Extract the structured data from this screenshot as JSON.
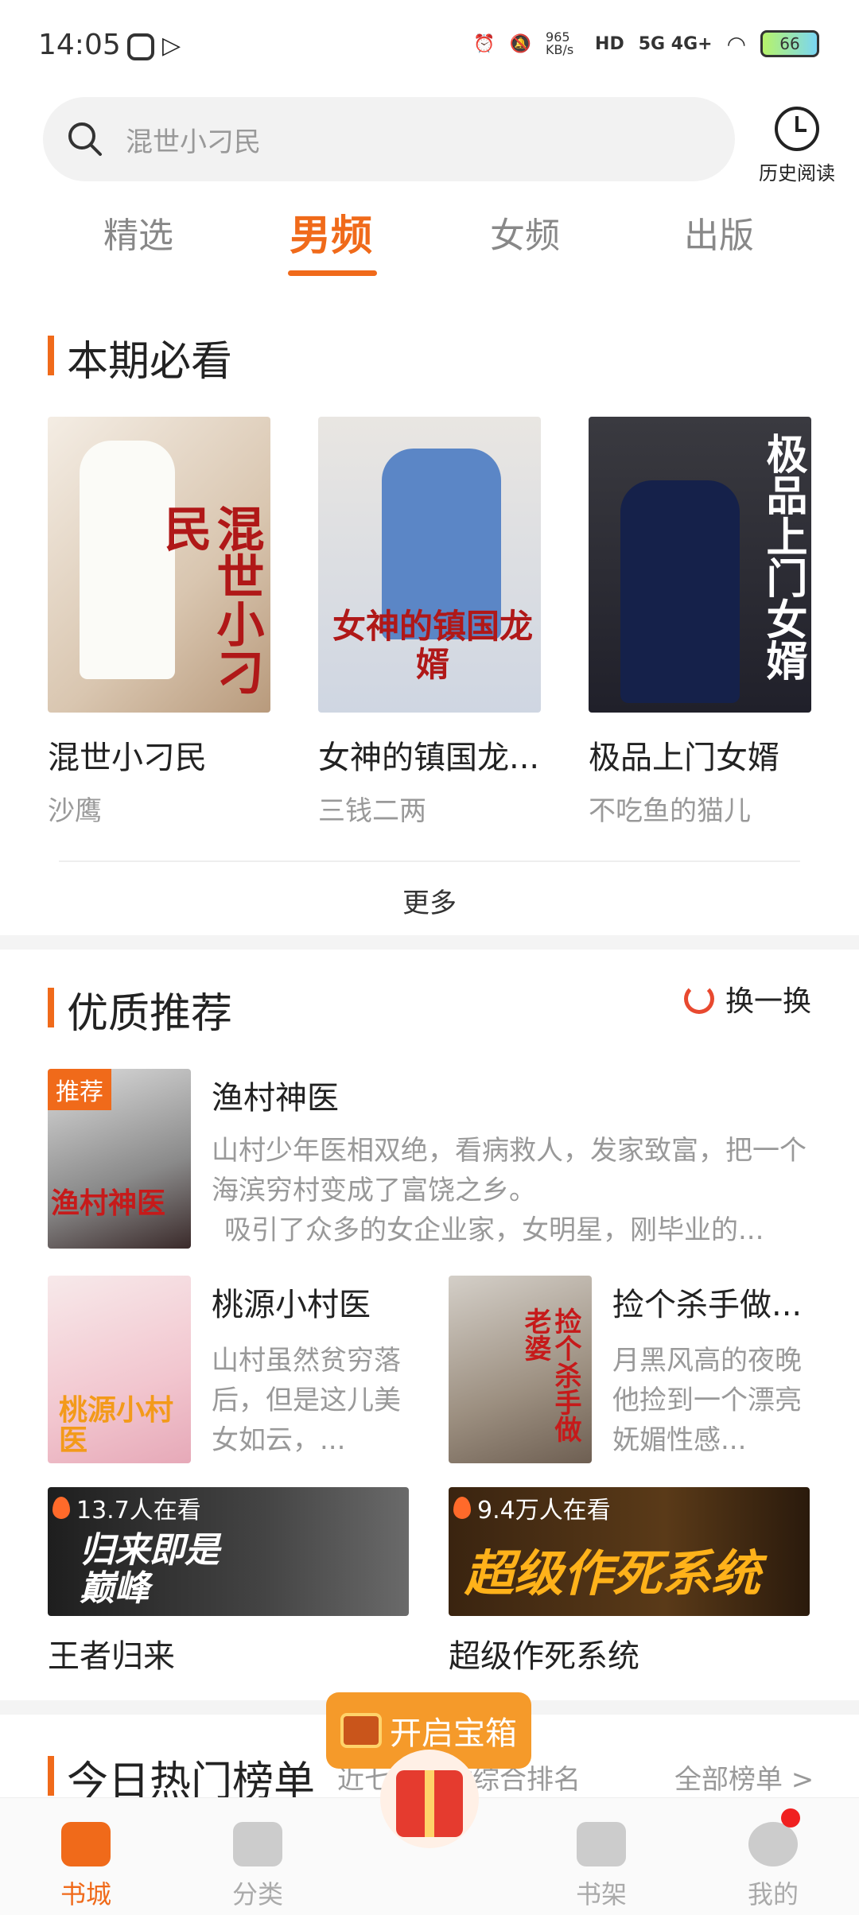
{
  "status": {
    "time": "14:05",
    "speed": "965 KB/s",
    "battery": "66",
    "net": "5G 4G+"
  },
  "search": {
    "placeholder": "混世小刁民"
  },
  "history": {
    "label": "历史阅读"
  },
  "tabs": [
    "精选",
    "男频",
    "女频",
    "出版"
  ],
  "must_read": {
    "title": "本期必看",
    "books": [
      {
        "title": "混世小刁民",
        "author": "沙鹰",
        "cover_text": "混世小刁民"
      },
      {
        "title": "女神的镇国龙...",
        "author": "三钱二两",
        "cover_text": "女神的镇国龙婿"
      },
      {
        "title": "极品上门女婿",
        "author": "不吃鱼的猫儿",
        "cover_text": "极品上门女婿"
      }
    ],
    "more": "更多"
  },
  "recommend": {
    "title": "优质推荐",
    "refresh": "换一换",
    "featured": {
      "badge": "推荐",
      "title": "渔村神医",
      "desc": "山村少年医相双绝，看病救人，发家致富，把一个海滨穷村变成了富饶之乡。",
      "desc2": "吸引了众多的女企业家，女明星，刚毕业的...",
      "cover_text": "渔村神医"
    },
    "pair": [
      {
        "title": "桃源小村医",
        "desc": "山村虽然贫穷落后，但是这儿美女如云，...",
        "cover_text": "桃源小村医"
      },
      {
        "title": "捡个杀手做...",
        "desc": "月黑风高的夜晚他捡到一个漂亮妩媚性感...",
        "cover_text": "捡个杀手做老婆"
      }
    ],
    "wide": [
      {
        "title": "王者归来",
        "watching": "13.7人在看",
        "cover_text": "归来即是巅峰"
      },
      {
        "title": "超级作死系统",
        "watching": "9.4万人在看",
        "cover_text": "超级作死系统"
      }
    ]
  },
  "treasure": {
    "label": "开启宝箱"
  },
  "hot": {
    "title": "今日热门榜单",
    "subtitle": "近七天全站综合排名",
    "all": "全部榜单 >"
  },
  "nav": [
    "书城",
    "分类",
    "书架",
    "我的"
  ],
  "colors": {
    "accent": "#f06a1a"
  }
}
